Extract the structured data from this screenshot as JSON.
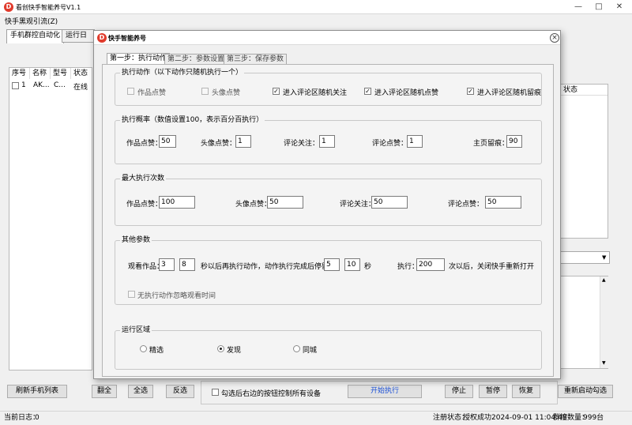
{
  "app": {
    "title": "看创快手智能养号V1.1",
    "menu": [
      "快手黑观引流(Z)"
    ],
    "tabs": [
      "手机群控自动化",
      "运行日志"
    ],
    "window_controls": [
      "minimize",
      "maximize",
      "close"
    ]
  },
  "device_table": {
    "headers": [
      "序号",
      "名称",
      "型号",
      "状态"
    ],
    "rows": [
      {
        "index": "1",
        "name": "AK...",
        "model": "C...",
        "status": "在线",
        "checked": false
      }
    ],
    "right_header": "状态"
  },
  "bottom_buttons": {
    "refresh": "刷新手机列表",
    "invert": "翻全",
    "select_all": "全选",
    "deselect": "反选",
    "sync_check": "勾选后右边的按钮控制所有设备",
    "start": "开始执行",
    "stop": "停止",
    "pause": "暂停",
    "resume": "恢复",
    "restart": "重新启动勾选"
  },
  "status": {
    "log_label": "当前日志：",
    "log_count": "0",
    "reg_label": "注册状态：",
    "reg_value": "授权成功",
    "expire": "2024-09-01 11:04:48",
    "devices_label": "群控数量：",
    "devices_value": "999台"
  },
  "modal": {
    "title": "快手智能养号",
    "tabs": [
      "第一步：执行动作",
      "第二步：参数设置",
      "第三步：保存参数"
    ],
    "actions_group": {
      "legend": "执行动作（以下动作只随机执行一个）",
      "items": [
        {
          "label": "作品点赞",
          "checked": false,
          "enabled": false
        },
        {
          "label": "头像点赞",
          "checked": false,
          "enabled": false
        },
        {
          "label": "进入评论区随机关注",
          "checked": true,
          "enabled": true
        },
        {
          "label": "进入评论区随机点赞",
          "checked": true,
          "enabled": true
        },
        {
          "label": "进入评论区随机留痕",
          "checked": true,
          "enabled": true
        }
      ]
    },
    "rate_group": {
      "legend": "执行概率（数值设置100，表示百分百执行）",
      "fields": [
        {
          "label": "作品点赞：",
          "value": "50"
        },
        {
          "label": "头像点赞：",
          "value": "1"
        },
        {
          "label": "评论关注：",
          "value": "1"
        },
        {
          "label": "评论点赞：",
          "value": "1"
        },
        {
          "label": "主页留痕：",
          "value": "90"
        }
      ]
    },
    "max_group": {
      "legend": "最大执行次数",
      "fields": [
        {
          "label": "作品点赞：",
          "value": "100"
        },
        {
          "label": "头像点赞：",
          "value": "50"
        },
        {
          "label": "评论关注：",
          "value": "50"
        },
        {
          "label": "评论点赞：",
          "value": "50"
        }
      ]
    },
    "other_group": {
      "legend": "其他参数",
      "watch_label": "观看作品：",
      "watch_min": "3",
      "watch_max": "8",
      "mid_text": "秒以后再执行动作，动作执行完成后停留",
      "stay_min": "5",
      "stay_max": "10",
      "sec": "秒",
      "exec_label": "执行：",
      "exec_value": "200",
      "exec_suffix": "次以后，关闭快手重新打开",
      "ignore_label": "无执行动作忽略观看时间",
      "ignore_checked": false
    },
    "region_group": {
      "legend": "运行区域",
      "options": [
        {
          "label": "精选",
          "selected": false
        },
        {
          "label": "发现",
          "selected": true
        },
        {
          "label": "同城",
          "selected": false
        }
      ]
    }
  }
}
